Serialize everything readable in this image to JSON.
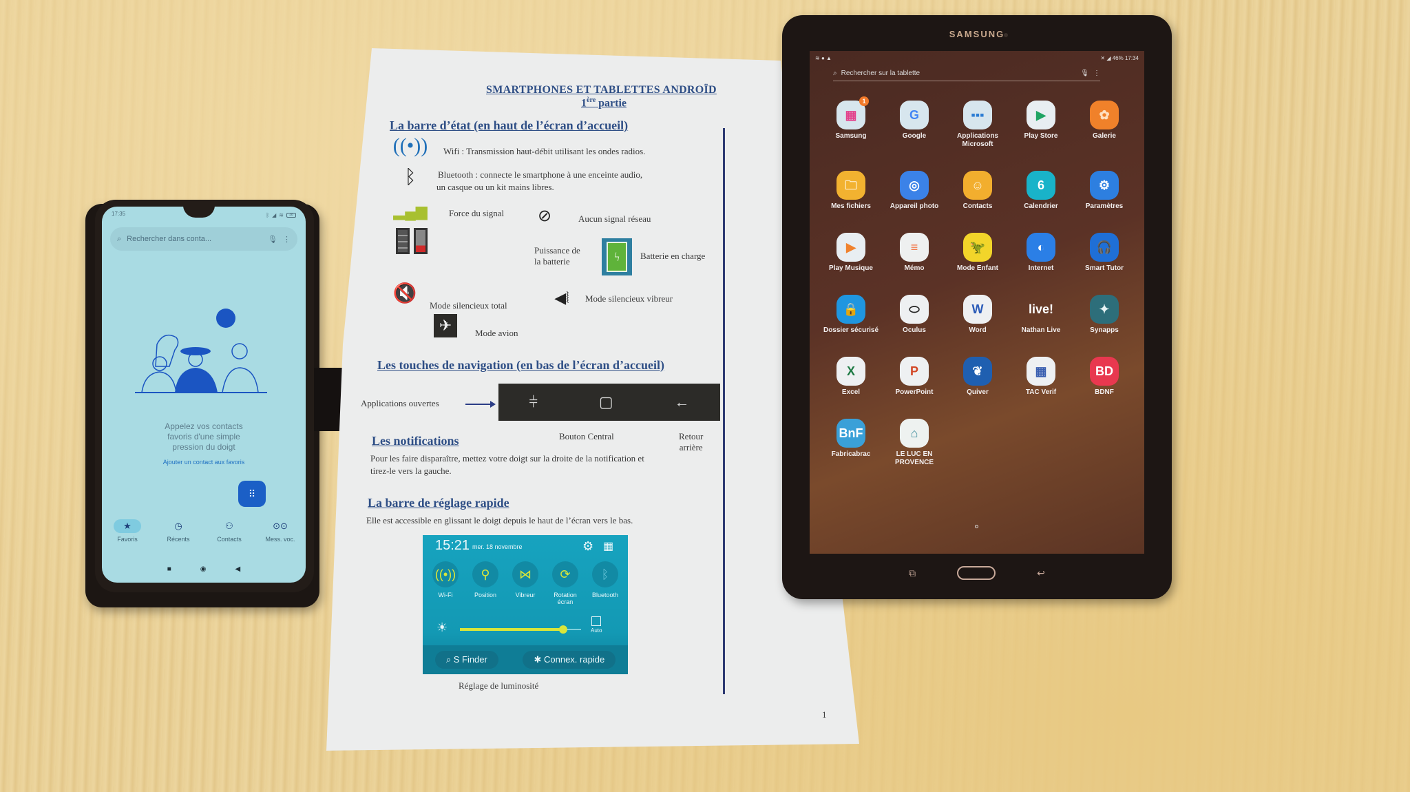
{
  "phone": {
    "status_time": "17:35",
    "battery": "38",
    "search_placeholder": "Rechercher dans conta...",
    "message": [
      "Appelez vos contacts",
      "favoris d'une simple",
      "pression du doigt"
    ],
    "add_favorite_link": "Ajouter un contact aux favoris",
    "tabs": [
      {
        "label": "Favoris",
        "icon": "star-icon",
        "glyph": "★",
        "active": true
      },
      {
        "label": "Récents",
        "icon": "clock-icon",
        "glyph": "◷",
        "active": false
      },
      {
        "label": "Contacts",
        "icon": "people-icon",
        "glyph": "👥",
        "active": false
      },
      {
        "label": "Mess. voc.",
        "icon": "voicemail-icon",
        "glyph": "⊙⊙",
        "active": false
      }
    ],
    "sysnav": {
      "recents": "■",
      "home": "◉",
      "back": "◀"
    }
  },
  "document": {
    "title": "SMARTPHONES ET TABLETTES ANDROÏD",
    "subtitle_num": "1",
    "subtitle_sup": "ère",
    "subtitle_word": "partie",
    "section_status_bar": "La barre d’état (en haut de l’écran d’accueil)",
    "wifi_text": "Wifi : Transmission haut-débit utilisant les ondes radios.",
    "bluetooth_text_1": "Bluetooth : connecte le smartphone à une enceinte audio,",
    "bluetooth_text_2": "un casque ou un kit mains libres.",
    "signal_text": "Force du signal",
    "no_signal_text": "Aucun signal réseau",
    "battery_power_text_1": "Puissance de",
    "battery_power_text_2": "la batterie",
    "battery_charging_text": "Batterie en charge",
    "silent_total_text": "Mode silencieux total",
    "silent_vibrate_text": "Mode silencieux vibreur",
    "airplane_text": "Mode avion",
    "section_navigation": "Les touches de navigation (en bas de l’écran d’accueil)",
    "open_apps_label": "Applications ouvertes",
    "central_button_label": "Bouton Central",
    "back_label_1": "Retour",
    "back_label_2": "arrière",
    "section_notifications": "Les notifications",
    "notifications_text_1": "Pour les faire disparaître, mettez votre doigt sur la droite de la notification et",
    "notifications_text_2": "tirez-le vers la gauche.",
    "section_quick_settings": "La barre de réglage rapide",
    "quick_settings_text": "Elle est accessible en glissant le doigt depuis le haut de l’écran vers le bas.",
    "quick_settings_panel": {
      "time": "15:21",
      "date": "mer. 18 novembre",
      "tiles": [
        {
          "label": "Wi-Fi",
          "glyph": "((•))",
          "on": true
        },
        {
          "label": "Position",
          "glyph": "⚲",
          "on": true
        },
        {
          "label": "Vibreur",
          "glyph": "⋈",
          "on": true
        },
        {
          "label": "Rotation écran",
          "glyph": "⟳",
          "on": true
        },
        {
          "label": "Bluetooth",
          "glyph": "ᛒ",
          "on": false
        }
      ],
      "brightness_level": 0.85,
      "auto_label": "Auto",
      "s_finder": "S Finder",
      "quick_connect": "Connex. rapide"
    },
    "brightness_caption": "Réglage de luminosité",
    "page_number": "1"
  },
  "tablet": {
    "brand": "SAMSUNG",
    "status_right": "46% 17:34",
    "search_placeholder": "Rechercher sur la tablette",
    "apps": [
      {
        "label": "Samsung",
        "badge": "1",
        "bg": "#d7e6ee",
        "fg": "#e2428c",
        "glyph": "▦"
      },
      {
        "label": "Google",
        "bg": "#d7e6ee",
        "fg": "#4285f4",
        "glyph": "G"
      },
      {
        "label": "Applications Microsoft",
        "bg": "#d7e6ee",
        "fg": "#2b7cd3",
        "glyph": "▪▪▪"
      },
      {
        "label": "Play Store",
        "bg": "#e8eef2",
        "fg": "#1fa463",
        "glyph": "▶"
      },
      {
        "label": "Galerie",
        "bg": "#f0812a",
        "fg": "#ffe0c0",
        "glyph": "✿"
      },
      {
        "label": "Mes fichiers",
        "bg": "#f2b230",
        "fg": "#fff3d6",
        "glyph": "🗀"
      },
      {
        "label": "Appareil photo",
        "bg": "#3b82e8",
        "fg": "#ffffff",
        "glyph": "◎"
      },
      {
        "label": "Contacts",
        "bg": "#f2ae2e",
        "fg": "#fff3d6",
        "glyph": "☺"
      },
      {
        "label": "Calendrier",
        "bg": "#19b3c9",
        "fg": "#ffffff",
        "glyph": "6"
      },
      {
        "label": "Paramètres",
        "bg": "#2d7fe0",
        "fg": "#ffffff",
        "glyph": "⚙"
      },
      {
        "label": "Play Musique",
        "bg": "#e8eef2",
        "fg": "#f0822e",
        "glyph": "▶"
      },
      {
        "label": "Mémo",
        "bg": "#eef0f0",
        "fg": "#f26d3a",
        "glyph": "≡"
      },
      {
        "label": "Mode Enfant",
        "bg": "#f2d52a",
        "fg": "#2aa84a",
        "glyph": "🦖"
      },
      {
        "label": "Internet",
        "bg": "#2b7fe6",
        "fg": "#ffffff",
        "glyph": "◐"
      },
      {
        "label": "Smart Tutor",
        "bg": "#1f6fd6",
        "fg": "#ffffff",
        "glyph": "🎧"
      },
      {
        "label": "Dossier sécurisé",
        "bg": "#1f96e0",
        "fg": "#ffffff",
        "glyph": "🔒"
      },
      {
        "label": "Oculus",
        "bg": "#eef0f2",
        "fg": "#222222",
        "glyph": "⬭"
      },
      {
        "label": "Word",
        "bg": "#eef0f2",
        "fg": "#2b5bb8",
        "glyph": "W"
      },
      {
        "label": "Nathan Live",
        "bg": "transparent",
        "fg": "#ffffff",
        "glyph": "live!"
      },
      {
        "label": "Synapps",
        "bg": "#2d6e7a",
        "fg": "#e6f3f4",
        "glyph": "✦"
      },
      {
        "label": "Excel",
        "bg": "#eef0f2",
        "fg": "#1e7a44",
        "glyph": "X"
      },
      {
        "label": "PowerPoint",
        "bg": "#eef0f2",
        "fg": "#d24726",
        "glyph": "P"
      },
      {
        "label": "Quiver",
        "bg": "#1f5fb0",
        "fg": "#ffffff",
        "glyph": "❦"
      },
      {
        "label": "TAC Verif",
        "bg": "#eef0f2",
        "fg": "#3a5fb0",
        "glyph": "▦"
      },
      {
        "label": "BDNF",
        "bg": "#e8384f",
        "fg": "#ffffff",
        "glyph": "BD"
      },
      {
        "label": "Fabricabrac",
        "bg": "#3aa0d8",
        "fg": "#ffffff",
        "glyph": "BnF"
      },
      {
        "label": "LE LUC EN PROVENCE",
        "bg": "#eef2f0",
        "fg": "#3a8a9a",
        "glyph": "⌂"
      }
    ],
    "keys": {
      "recents": "⧉",
      "back": "↩"
    }
  }
}
